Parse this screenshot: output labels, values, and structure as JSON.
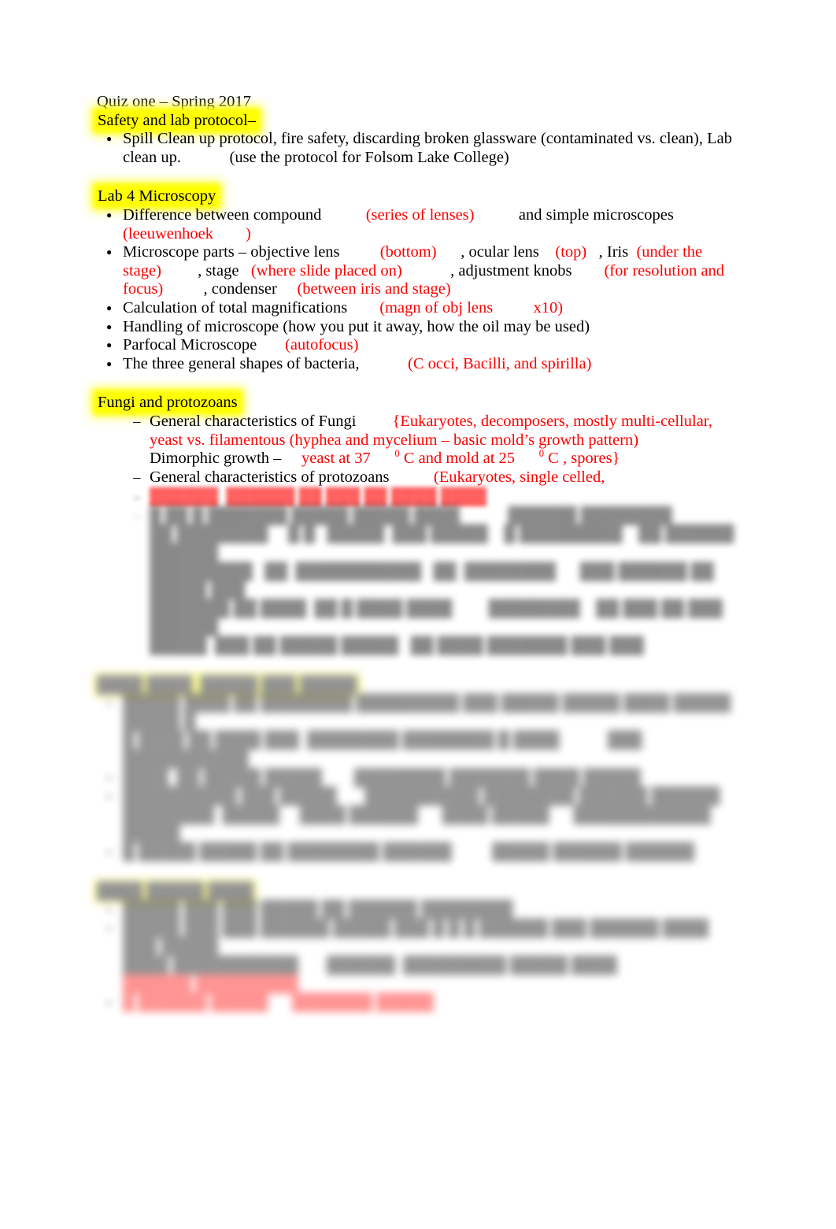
{
  "document": {
    "title": "Quiz one – Spring 2017",
    "colors": {
      "highlight": "#ffff00",
      "answer_red": "#ff0000",
      "text": "#000000",
      "page_background": "#ffffff"
    },
    "sections": [
      {
        "heading": "Safety and lab protocol–",
        "heading_highlighted": true,
        "list_type": "bullet",
        "items": [
          {
            "runs": [
              {
                "text": "Spill Clean up protocol, fire safety, discarding broken glassware (contaminated vs. clean), Lab clean up.",
                "color": "black"
              },
              {
                "text": "            ",
                "color": "black"
              },
              {
                "text": "(use the protocol for Folsom Lake College)",
                "color": "black"
              }
            ]
          }
        ]
      },
      {
        "heading": "Lab 4 Microscopy",
        "heading_highlighted": true,
        "list_type": "bullet",
        "items": [
          {
            "runs": [
              {
                "text": "Difference between compound",
                "color": "black"
              },
              {
                "text": "           ",
                "color": "black"
              },
              {
                "text": "(series of lenses)",
                "color": "red"
              },
              {
                "text": "           ",
                "color": "black"
              },
              {
                "text": "and simple microscopes",
                "color": "black"
              },
              {
                "text": "    ",
                "color": "black"
              },
              {
                "text": "(leeuwenhoek",
                "color": "red"
              },
              {
                "text": "        ",
                "color": "black"
              },
              {
                "text": ")",
                "color": "red"
              }
            ]
          },
          {
            "runs": [
              {
                "text": "Microscope parts – objective lens",
                "color": "black"
              },
              {
                "text": "          ",
                "color": "black"
              },
              {
                "text": "(bottom)",
                "color": "red"
              },
              {
                "text": "      ",
                "color": "black"
              },
              {
                "text": ", ocular lens",
                "color": "black"
              },
              {
                "text": "    ",
                "color": "black"
              },
              {
                "text": "(top)",
                "color": "red"
              },
              {
                "text": "   ",
                "color": "black"
              },
              {
                "text": ", Iris",
                "color": "black"
              },
              {
                "text": "  ",
                "color": "black"
              },
              {
                "text": "(under the stage)",
                "color": "red"
              },
              {
                "text": "         ",
                "color": "black"
              },
              {
                "text": ", stage",
                "color": "black"
              },
              {
                "text": "   ",
                "color": "black"
              },
              {
                "text": "(where slide placed on)",
                "color": "red"
              },
              {
                "text": "            ",
                "color": "black"
              },
              {
                "text": ", adjustment knobs",
                "color": "black"
              },
              {
                "text": "        ",
                "color": "black"
              },
              {
                "text": "(for resolution and focus)",
                "color": "red"
              },
              {
                "text": "          ",
                "color": "black"
              },
              {
                "text": ", condenser",
                "color": "black"
              },
              {
                "text": "     ",
                "color": "black"
              },
              {
                "text": "(between iris and stage)",
                "color": "red"
              }
            ]
          },
          {
            "runs": [
              {
                "text": "Calculation of total magnifications",
                "color": "black"
              },
              {
                "text": "        ",
                "color": "black"
              },
              {
                "text": "(magn of obj lens",
                "color": "red"
              },
              {
                "text": "          ",
                "color": "black"
              },
              {
                "text": "x10)",
                "color": "red"
              }
            ]
          },
          {
            "runs": [
              {
                "text": "Handling of microscope (how you put it away, how the oil may be used)",
                "color": "black"
              }
            ]
          },
          {
            "runs": [
              {
                "text": "Parfocal Microscope",
                "color": "black"
              },
              {
                "text": "       ",
                "color": "black"
              },
              {
                "text": "(autofocus)",
                "color": "red"
              }
            ]
          },
          {
            "runs": [
              {
                "text": "The three general shapes of bacteria,",
                "color": "black"
              },
              {
                "text": "            ",
                "color": "black"
              },
              {
                "text": "(C occi, Bacilli, and spirilla)",
                "color": "red"
              }
            ]
          }
        ]
      },
      {
        "heading": "Fungi and protozoans",
        "heading_highlighted": true,
        "list_type": "dash",
        "items": [
          {
            "runs": [
              {
                "text": "General characteristics of Fungi",
                "color": "black"
              },
              {
                "text": "         ",
                "color": "black"
              },
              {
                "text": "{Eukaryotes, decomposers, mostly multi-cellular, yeast vs. filamentous (hyphea and mycelium – basic mold’s growth pattern)",
                "color": "red"
              },
              {
                "text": "            ",
                "color": "black"
              },
              {
                "text": "Dimorphic growth –",
                "color": "black"
              },
              {
                "text": "     ",
                "color": "black"
              },
              {
                "text": "yeast at 37",
                "color": "red"
              },
              {
                "text": "      ",
                "color": "black"
              },
              {
                "text": "0",
                "color": "red",
                "superscript": true
              },
              {
                "text": " C and mold at 25",
                "color": "red"
              },
              {
                "text": "      ",
                "color": "black"
              },
              {
                "text": "0",
                "color": "red",
                "superscript": true
              },
              {
                "text": " C , spores}",
                "color": "red"
              }
            ]
          },
          {
            "runs": [
              {
                "text": "General characteristics of protozoans",
                "color": "black"
              },
              {
                "text": "           ",
                "color": "black"
              },
              {
                "text": "(Eukaryotes, single celled,",
                "color": "red"
              }
            ]
          }
        ]
      }
    ],
    "obscured_region": {
      "note": "Lower portion of the page is blurred and illegible in the screenshot.",
      "blocks": [
        {
          "id": "protozoan-answer-continuation",
          "blur": "heavy",
          "lines": [
            {
              "text": "██████  ██████ ██ ███ ██ ████ ████",
              "color": "red"
            }
          ]
        },
        {
          "id": "unreadable-dash-item",
          "blur": "heavy",
          "lines": [
            {
              "text": "█ ██ █ ███████ █████ █████ ████            ██████ ████████",
              "color": "black"
            },
            {
              "text": "██ ████████     █ █   █████  ███ █████    █ █████████    ██ ██████  ██████",
              "color": "black"
            },
            {
              "text": "█████████   ██  ███████████   ██  ████████      ███ ██████ ██ █████ ███",
              "color": "black"
            },
            {
              "text": "███████ ██ ████  ██ █ ████ ████         ████████    ██ ███ ██ ███ ██████",
              "color": "black"
            },
            {
              "text": "█████  ███ ██ █████ █████   ██ ████ ███████ ███ ███",
              "color": "black"
            }
          ]
        },
        {
          "id": "obscured-heading-1",
          "blur": "heavy",
          "highlighted": true,
          "lines": [
            {
              "text": "████ ████  █████ ███ █████",
              "color": "black"
            }
          ]
        },
        {
          "id": "obscured-numbered-list-1",
          "blur": "heavy",
          "lines": [
            {
              "text": "█████ ████ ██ ████████ █████████ ███ █████ █████ ████ █████ █████ █",
              "color": "black"
            },
            {
              "text": "█ ████ ██ ████ ███  ████████ ████████ █ ████            ███ ███████████",
              "color": "mixed"
            },
            {
              "text": "████  ██ █████ █████        ████████ ███████ ████ █████",
              "color": "mixed"
            },
            {
              "text": "██████████ ███ █████       ██████████ ████████ ██████ ██████",
              "color": "mixed"
            },
            {
              "text": "████████  █████     ████ ██████      ████ █████      ████████████ █████",
              "color": "mixed"
            },
            {
              "text": "█ █████ █████ ██ ████████ ██████          █████ ██████ ██████",
              "color": "mixed"
            }
          ]
        },
        {
          "id": "obscured-heading-2",
          "blur": "heavy",
          "highlighted": true,
          "lines": [
            {
              "text": "████ █████ ████",
              "color": "black"
            }
          ]
        },
        {
          "id": "obscured-numbered-list-2",
          "blur": "heavy",
          "lines": [
            {
              "text": "█████ ███ ███ █████ ██ ██████ ████████",
              "color": "black"
            },
            {
              "text": "█████ ███ ███ ██████ █████ ███ █ █ █ ██████ ███ ██████ ████ ███ █████",
              "color": "black"
            },
            {
              "text": "████ ███████████       ██████  █████████ █████ ████",
              "color": "mixed"
            },
            {
              "text": "██████ █████████",
              "color": "red"
            },
            {
              "text": "█ ██████ █████      ███████ █████",
              "color": "mixed"
            }
          ]
        }
      ]
    }
  }
}
